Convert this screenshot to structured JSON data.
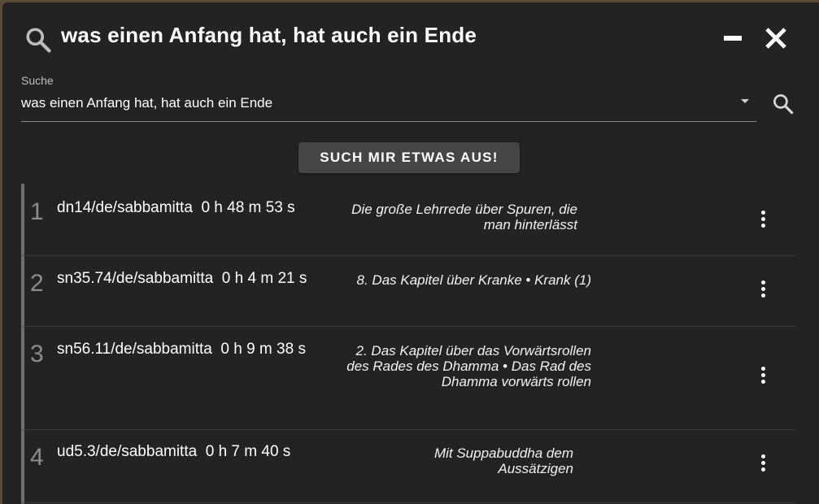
{
  "header": {
    "title": "was einen Anfang hat, hat auch ein Ende"
  },
  "search": {
    "label": "Suche",
    "value": "was einen Anfang hat, hat auch ein Ende"
  },
  "pick_button": "SUCH MIR ETWAS AUS!",
  "results": [
    {
      "num": "1",
      "id": "dn14/de/sabbamitta  0 h 48 m 53 s",
      "desc": "Die große Lehrrede über Spuren, die man hinterlässt"
    },
    {
      "num": "2",
      "id": "sn35.74/de/sabbamitta  0 h 4 m 21 s",
      "desc": "8. Das Kapitel über Kranke • Krank (1)"
    },
    {
      "num": "3",
      "id": "sn56.11/de/sabbamitta  0 h 9 m 38 s",
      "desc": "2. Das Kapitel über das Vorwärtsrollen des Rades des Dhamma • Das Rad des Dhamma vorwärts rollen"
    },
    {
      "num": "4",
      "id": "ud5.3/de/sabbamitta  0 h 7 m 40 s",
      "desc": "Mit Suppabuddha dem Aussätzigen"
    }
  ]
}
